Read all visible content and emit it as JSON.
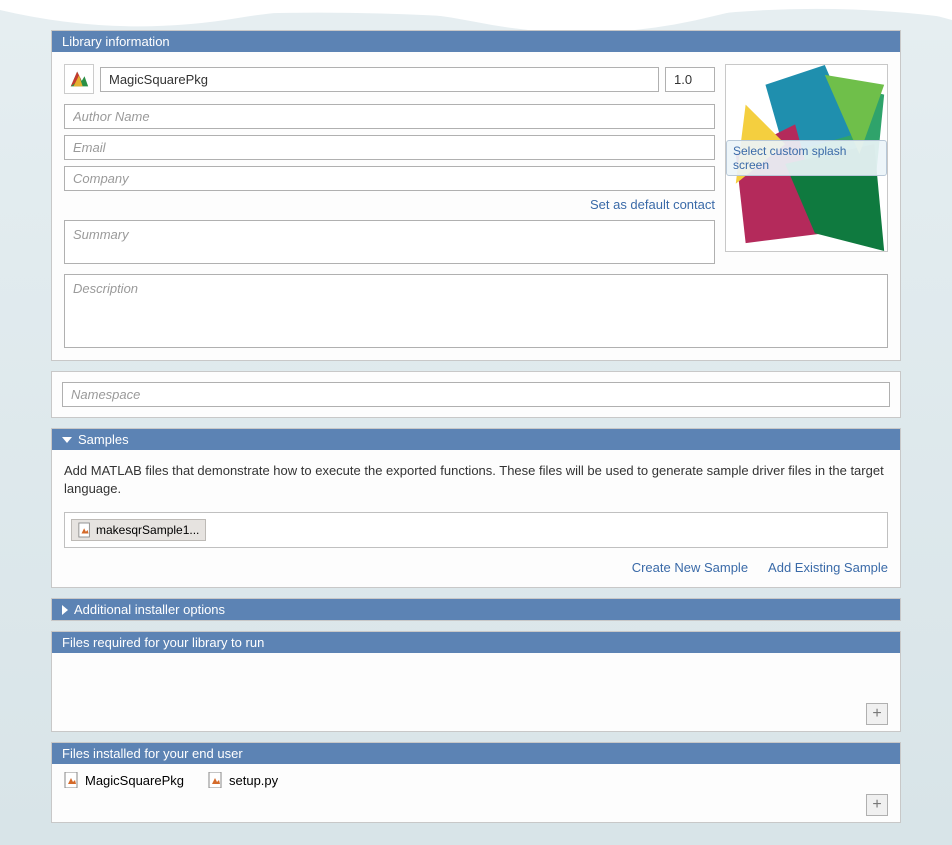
{
  "sections": {
    "library_info": {
      "title": "Library information"
    },
    "samples": {
      "title": "Samples"
    },
    "additional_installer": {
      "title": "Additional installer options"
    },
    "files_required": {
      "title": "Files required for your library to run"
    },
    "files_installed": {
      "title": "Files installed for your end user"
    }
  },
  "library": {
    "name_value": "MagicSquarePkg",
    "version_value": "1.0",
    "author_placeholder": "Author Name",
    "email_placeholder": "Email",
    "company_placeholder": "Company",
    "set_default_link": "Set as default contact",
    "summary_placeholder": "Summary",
    "description_placeholder": "Description",
    "splash_label": "Select custom splash screen"
  },
  "namespace": {
    "placeholder": "Namespace"
  },
  "samples": {
    "description": "Add MATLAB files that demonstrate how to execute the exported functions.  These files will be used to generate sample driver files in the target language.",
    "items": [
      "makesqrSample1..."
    ],
    "create_link": "Create New Sample",
    "add_link": "Add Existing Sample"
  },
  "files_installed": {
    "items": [
      "MagicSquarePkg",
      "setup.py"
    ]
  }
}
